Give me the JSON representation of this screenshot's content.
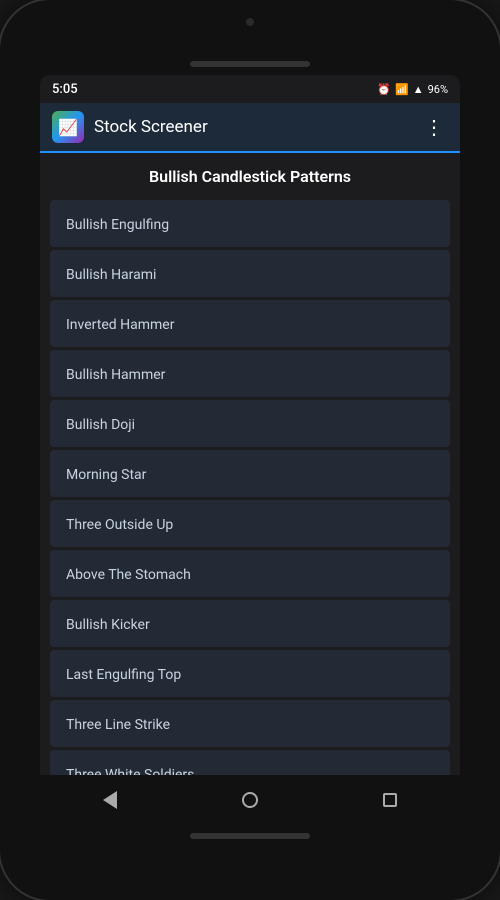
{
  "status": {
    "time": "5:05",
    "battery": "96%",
    "icons": "⏰ ✈ ▲ 📶"
  },
  "appBar": {
    "title": "Stock Screener",
    "menuIcon": "⋮"
  },
  "content": {
    "sectionTitle": "Bullish Candlestick Patterns",
    "items": [
      {
        "label": "Bullish Engulfing"
      },
      {
        "label": "Bullish Harami"
      },
      {
        "label": "Inverted Hammer"
      },
      {
        "label": "Bullish Hammer"
      },
      {
        "label": "Bullish Doji"
      },
      {
        "label": "Morning Star"
      },
      {
        "label": "Three Outside Up"
      },
      {
        "label": "Above The Stomach"
      },
      {
        "label": "Bullish Kicker"
      },
      {
        "label": "Last Engulfing Top"
      },
      {
        "label": "Three Line Strike"
      },
      {
        "label": "Three White Soldiers"
      }
    ]
  }
}
